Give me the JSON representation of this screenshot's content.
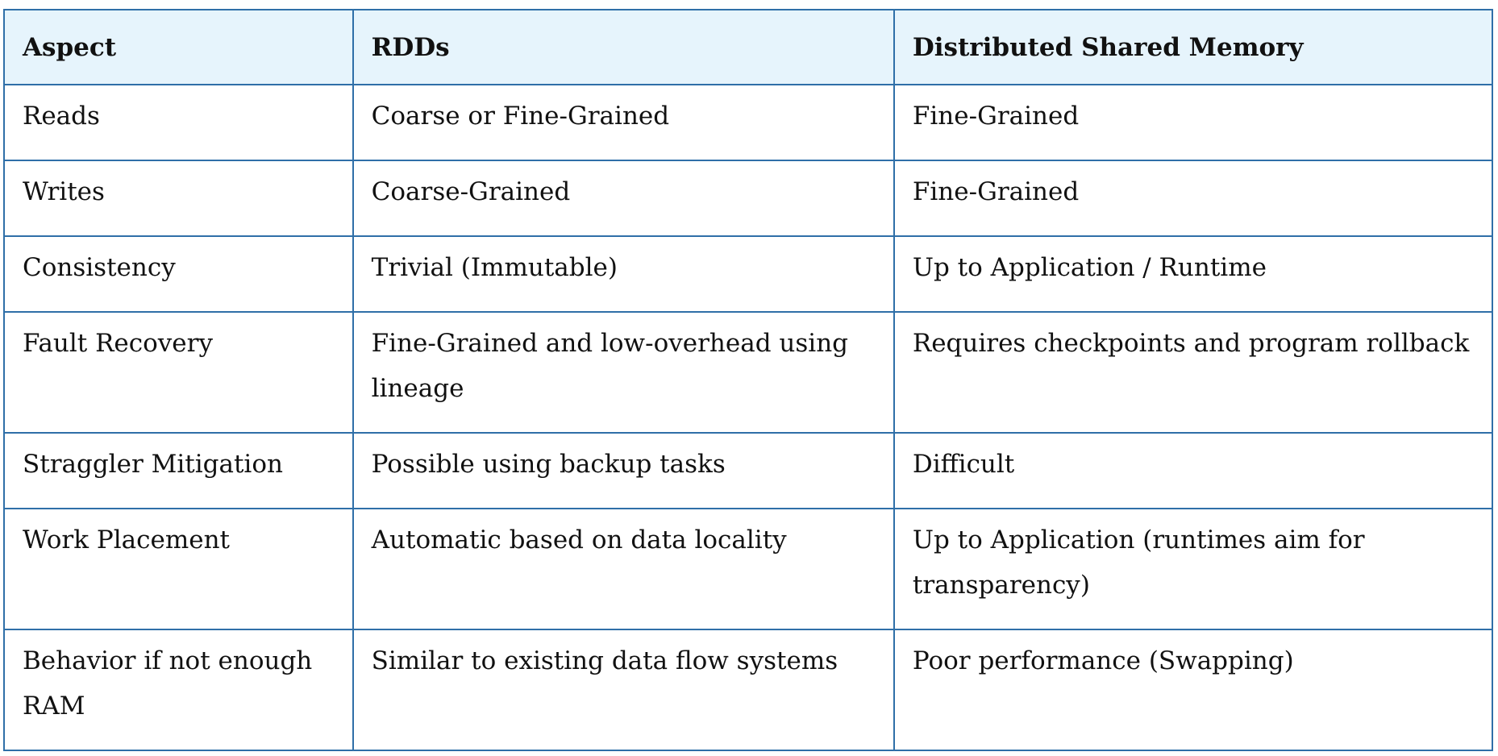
{
  "table": {
    "headers": [
      "Aspect",
      "RDDs",
      "Distributed Shared Memory"
    ],
    "rows": [
      [
        "Reads",
        "Coarse or Fine-Grained",
        "Fine-Grained"
      ],
      [
        "Writes",
        "Coarse-Grained",
        "Fine-Grained"
      ],
      [
        "Consistency",
        "Trivial (Immutable)",
        "Up to Application / Runtime"
      ],
      [
        "Fault Recovery",
        "Fine-Grained and low-overhead using lineage",
        "Requires checkpoints and program rollback"
      ],
      [
        "Straggler Mitigation",
        "Possible using backup tasks",
        "Difficult"
      ],
      [
        "Work Placement",
        "Automatic based on data locality",
        "Up to Application (runtimes aim for transparency)"
      ],
      [
        "Behavior if not enough RAM",
        "Similar to existing data flow systems",
        "Poor performance (Swapping)"
      ]
    ]
  },
  "colors": {
    "header_bg": "#e6f4fc",
    "border": "#2f6fa8"
  }
}
